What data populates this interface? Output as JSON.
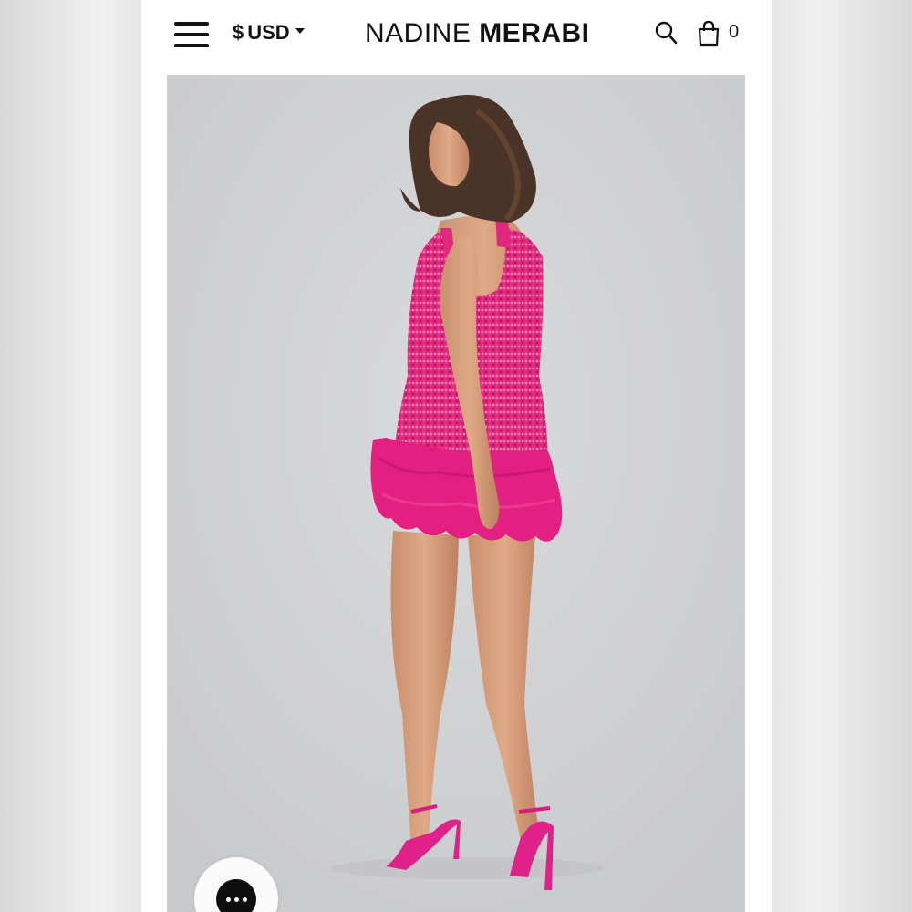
{
  "header": {
    "currency_symbol": "$",
    "currency_code": "USD",
    "logo_part1": "NADINE ",
    "logo_part2": "MERABI",
    "cart_count": "0",
    "icons": [
      "menu-icon",
      "caret-down-icon",
      "search-icon",
      "shopping-bag-icon"
    ]
  },
  "product": {
    "image_subject": "model in pink sequin mini dress with feather hem, back view",
    "dress_color": "#e8277f",
    "background_color": "#d2d3d5"
  },
  "chat": {
    "icon": "more-dots-icon"
  }
}
